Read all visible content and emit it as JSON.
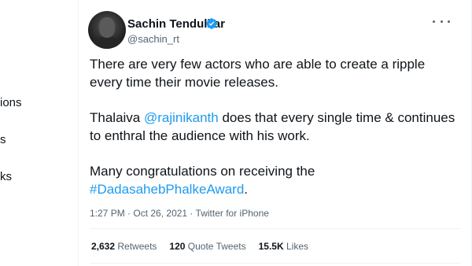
{
  "left_nav": {
    "items": [
      {
        "label": "ions"
      },
      {
        "label": "s"
      },
      {
        "label": "ks"
      }
    ]
  },
  "tweet": {
    "author": {
      "display_name": "Sachin Tendulkar",
      "handle": "@sachin_rt",
      "verified": true
    },
    "paragraphs": {
      "p1": "There are very few actors who are able to create a ripple every time their movie releases.",
      "p2_prefix": "Thalaiva ",
      "p2_mention": "@rajinikanth",
      "p2_suffix": " does that every single time & continues to enthral the audience with his work.",
      "p3_prefix": "Many congratulations on receiving the ",
      "p3_hashtag": "#DadasahebPhalkeAward",
      "p3_suffix": "."
    },
    "meta": {
      "time": "1:27 PM",
      "separator1": " · ",
      "date": "Oct 26, 2021",
      "separator2": " · ",
      "source": "Twitter for iPhone"
    },
    "stats": {
      "retweets_count": "2,632",
      "retweets_label": "Retweets",
      "quotes_count": "120",
      "quotes_label": "Quote Tweets",
      "likes_count": "15.5K",
      "likes_label": "Likes"
    }
  },
  "colors": {
    "accent": "#1d9bf0",
    "text_primary": "#0f1419",
    "text_secondary": "#536471",
    "border": "#eff3f4"
  },
  "icons": {
    "verified": "verified-badge-icon",
    "more": "more-dots-icon"
  }
}
